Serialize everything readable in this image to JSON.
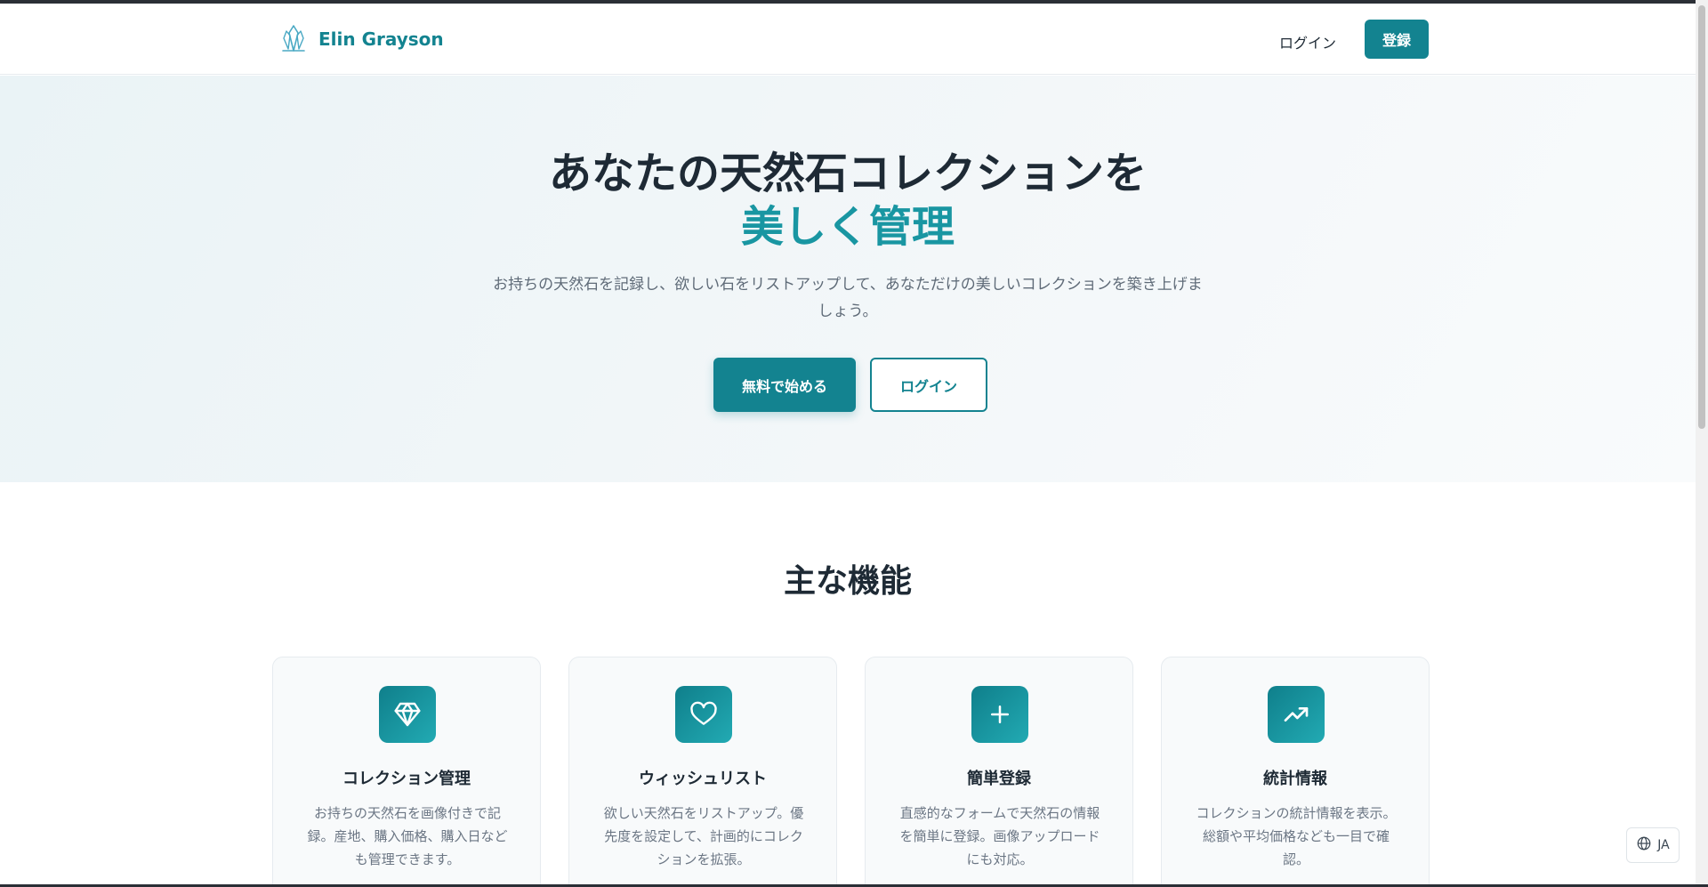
{
  "brand": {
    "name": "Elin Grayson",
    "icon": "crystal-icon",
    "color": "#138390"
  },
  "nav": {
    "login_label": "ログイン",
    "register_label": "登録"
  },
  "hero": {
    "title_line1": "あなたの天然石コレクションを",
    "title_line2": "美しく管理",
    "description": "お持ちの天然石を記録し、欲しい石をリストアップして、あなただけの美しいコレクションを築き上げましょう。",
    "primary_button": "無料で始める",
    "secondary_button": "ログイン"
  },
  "features": {
    "title": "主な機能",
    "items": [
      {
        "icon": "diamond-icon",
        "title": "コレクション管理",
        "description": "お持ちの天然石を画像付きで記録。産地、購入価格、購入日なども管理できます。"
      },
      {
        "icon": "heart-icon",
        "title": "ウィッシュリスト",
        "description": "欲しい天然石をリストアップ。優先度を設定して、計画的にコレクションを拡張。"
      },
      {
        "icon": "plus-icon",
        "title": "簡単登録",
        "description": "直感的なフォームで天然石の情報を簡単に登録。画像アップロードにも対応。"
      },
      {
        "icon": "trending-up-icon",
        "title": "統計情報",
        "description": "コレクションの統計情報を表示。総額や平均価格なども一目で確認。"
      }
    ]
  },
  "language": {
    "icon": "globe-icon",
    "code": "JA"
  },
  "colors": {
    "accent": "#138390",
    "accent_light": "#1996a2",
    "text": "#1e2a35"
  }
}
